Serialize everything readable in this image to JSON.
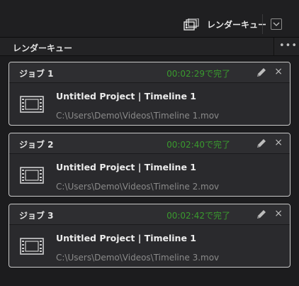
{
  "topbar": {
    "render_queue_label": "レンダーキュー"
  },
  "panel": {
    "title": "レンダーキュー",
    "more_label": "•••"
  },
  "jobs": [
    {
      "name": "ジョブ 1",
      "status": "00:02:29で完了",
      "project": "Untitled Project | Timeline 1",
      "path": "C:\\Users\\Demo\\Videos\\Timeline 1.mov"
    },
    {
      "name": "ジョブ 2",
      "status": "00:02:40で完了",
      "project": "Untitled Project | Timeline 1",
      "path": "C:\\Users\\Demo\\Videos\\Timeline 2.mov"
    },
    {
      "name": "ジョブ 3",
      "status": "00:02:42で完了",
      "project": "Untitled Project | Timeline 1",
      "path": "C:\\Users\\Demo\\Videos\\Timeline 3.mov"
    }
  ],
  "icons": {
    "close": "×"
  },
  "colors": {
    "status_complete": "#3a9a2e",
    "job_border": "#c9c9c9"
  }
}
